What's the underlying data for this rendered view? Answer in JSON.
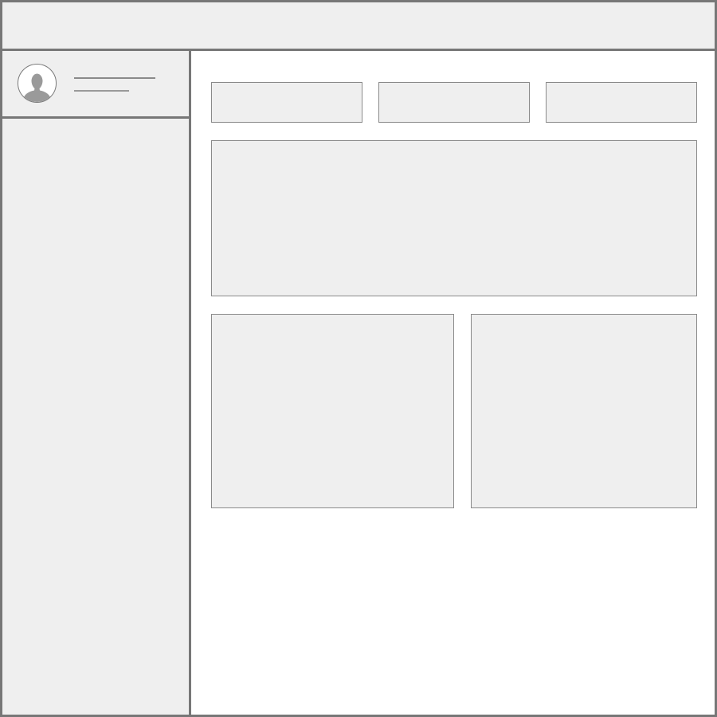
{
  "window": {
    "title": ""
  },
  "header": {
    "title": ""
  },
  "sidebar": {
    "profile": {
      "avatar_icon": "user-avatar-icon",
      "name": "",
      "subtitle": ""
    },
    "items": []
  },
  "main": {
    "stat_tiles": [
      {
        "label": ""
      },
      {
        "label": ""
      },
      {
        "label": ""
      }
    ],
    "wide_panel": {
      "title": ""
    },
    "bottom_panels": [
      {
        "title": ""
      },
      {
        "title": ""
      }
    ]
  },
  "colors": {
    "border": "#777777",
    "panel_fill": "#efefef",
    "background": "#ffffff",
    "avatar_silhouette": "#9a9a9a"
  }
}
